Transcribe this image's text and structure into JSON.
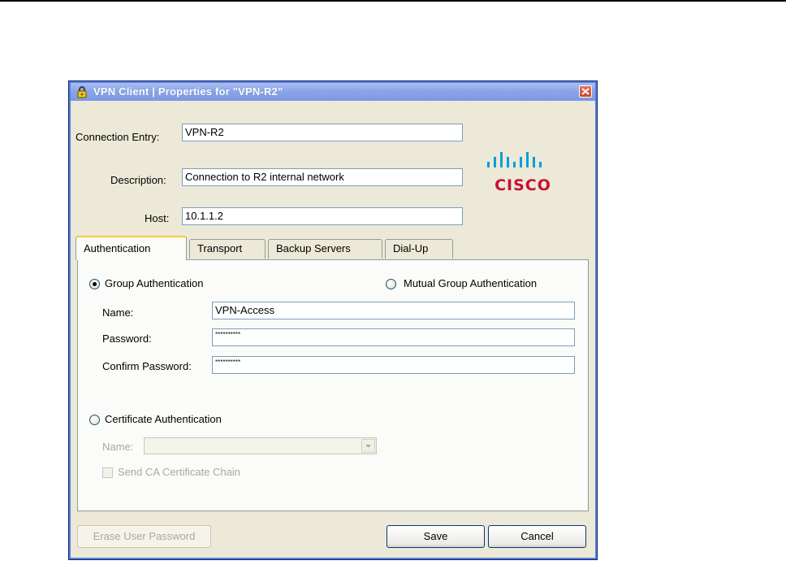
{
  "window": {
    "title": "VPN Client  |  Properties for \"VPN-R2\""
  },
  "header": {
    "connection_entry_label": "Connection Entry:",
    "connection_entry_value": "VPN-R2",
    "description_label": "Description:",
    "description_value": "Connection to R2 internal network",
    "host_label": "Host:",
    "host_value": "10.1.1.2"
  },
  "logo": {
    "text": "CISCO",
    "color": "#c8102e",
    "bar_color": "#049fd9"
  },
  "tabs": [
    {
      "label": "Authentication",
      "active": true
    },
    {
      "label": "Transport",
      "active": false
    },
    {
      "label": "Backup Servers",
      "active": false
    },
    {
      "label": "Dial-Up",
      "active": false
    }
  ],
  "auth": {
    "group_auth_label": "Group Authentication",
    "group_auth_selected": true,
    "mutual_group_label": "Mutual Group Authentication",
    "mutual_group_selected": false,
    "name_label": "Name:",
    "name_value": "VPN-Access",
    "password_label": "Password:",
    "password_value": "**********",
    "confirm_label": "Confirm Password:",
    "confirm_value": "**********",
    "cert_auth_label": "Certificate Authentication",
    "cert_auth_selected": false,
    "cert_name_label": "Name:",
    "cert_name_value": "",
    "send_ca_label": "Send CA Certificate Chain",
    "send_ca_checked": false
  },
  "footer": {
    "erase_label": "Erase User Password",
    "save_label": "Save",
    "cancel_label": "Cancel"
  }
}
